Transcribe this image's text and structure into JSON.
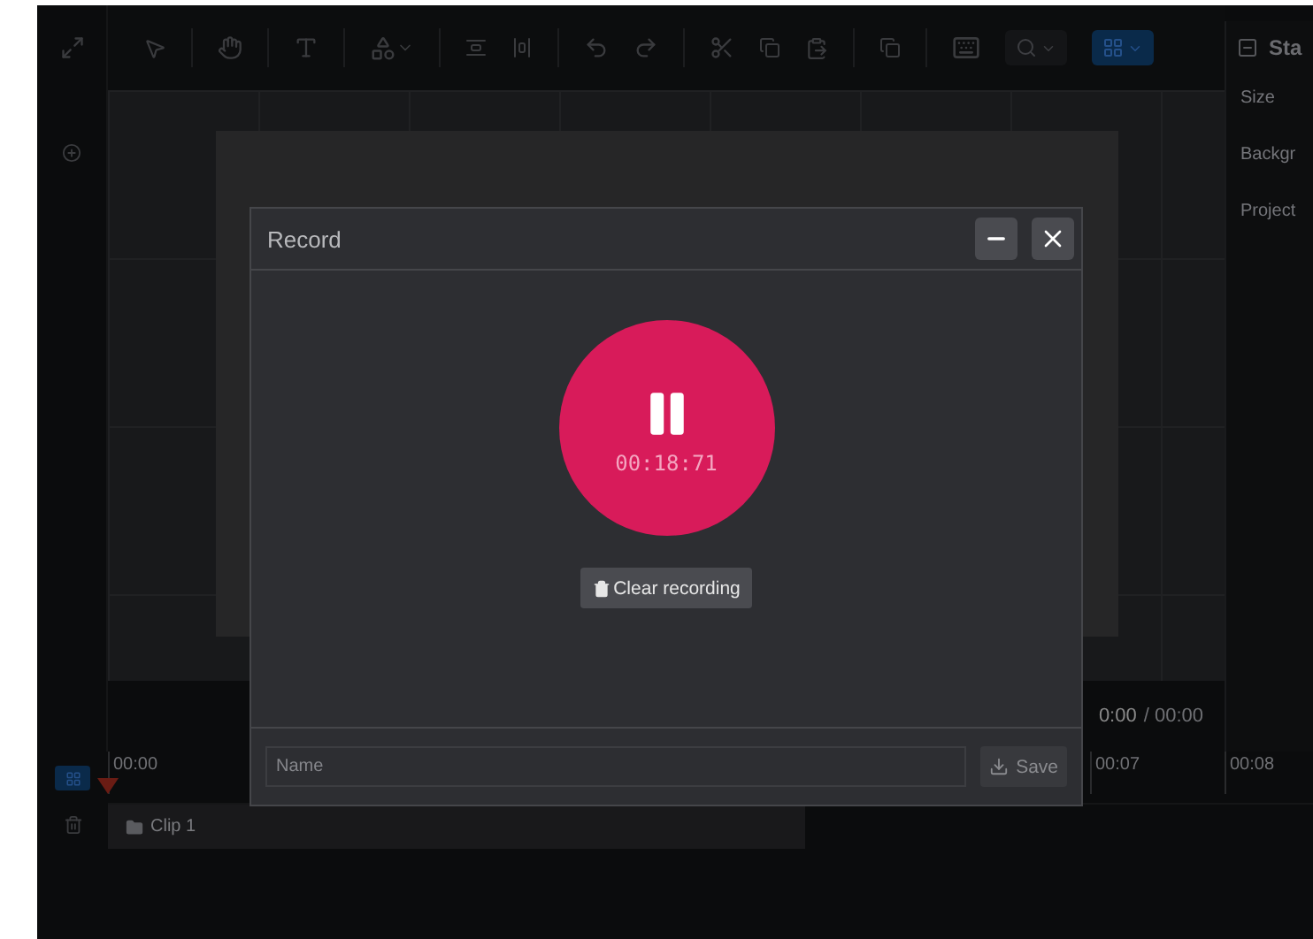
{
  "right_panel": {
    "title": "Sta",
    "rows": [
      "Size",
      "Backgr",
      "Project"
    ]
  },
  "player": {
    "current": "0:00",
    "total": "/ 00:00"
  },
  "ruler": {
    "labels": [
      "00:00",
      "00:07",
      "00:08"
    ]
  },
  "track": {
    "clip": "Clip 1"
  },
  "modal": {
    "title": "Record",
    "recording": true,
    "timer": "00:18:71",
    "clear_button": "Clear recording",
    "name_field": {
      "placeholder": "Name"
    },
    "save_button": "Save"
  }
}
